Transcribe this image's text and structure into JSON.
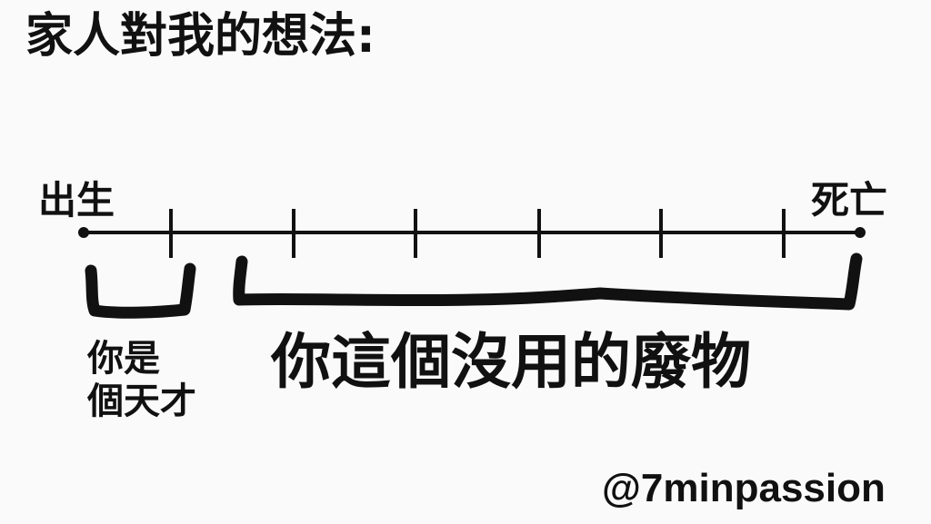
{
  "title": "家人對我的想法:",
  "timeline": {
    "start_label": "出生",
    "end_label": "死亡",
    "tick_count": 6
  },
  "brackets": {
    "early_line1": "你是",
    "early_line2": "個天才",
    "rest": "你這個沒用的廢物"
  },
  "watermark": "@7minpassion"
}
